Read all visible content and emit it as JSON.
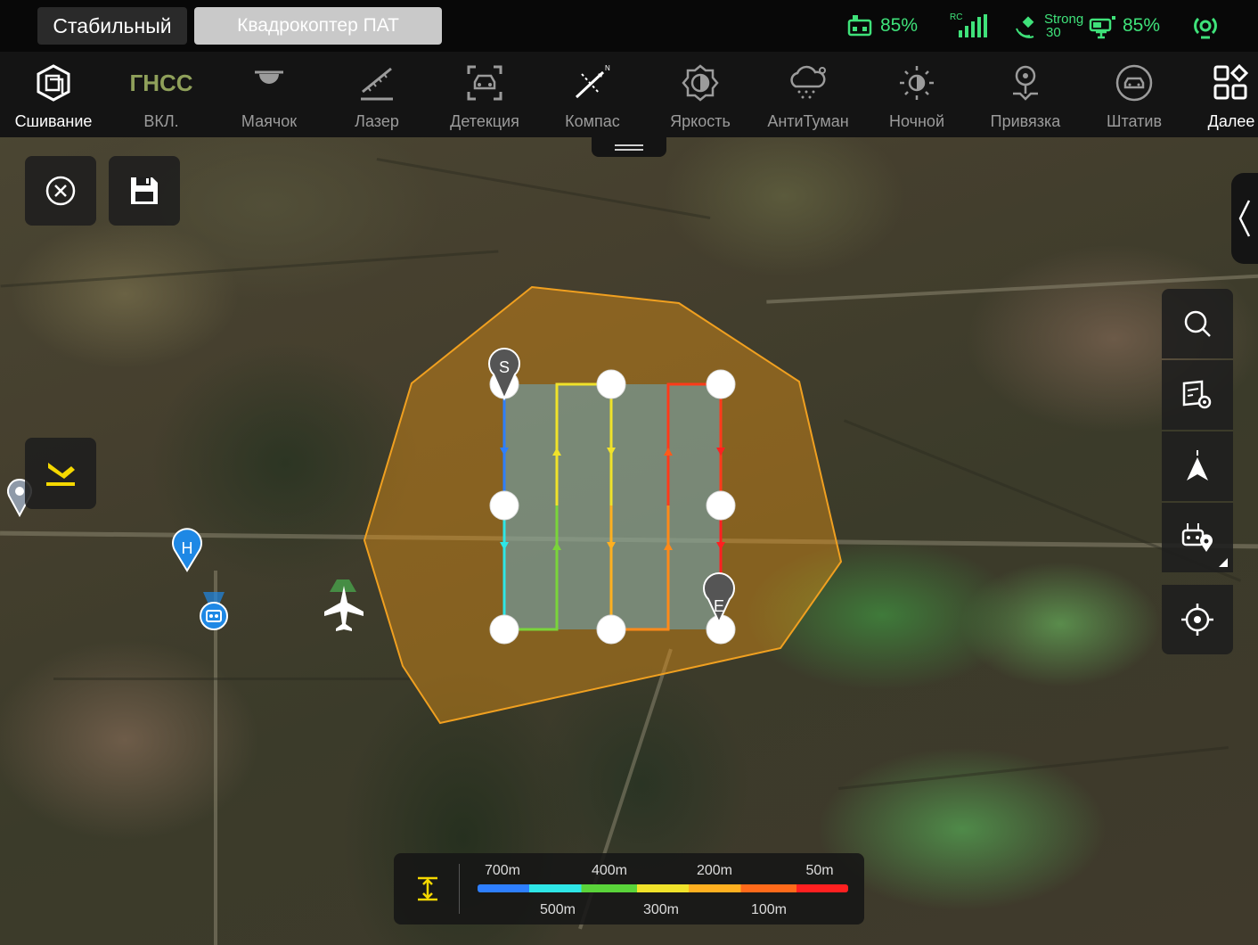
{
  "status_bar": {
    "mode": "Стабильный",
    "vehicle": "Квадрокоптер ПАТ",
    "rc_battery": "85%",
    "rc_label": "RC",
    "signal_text": "Strong",
    "signal_value": "30",
    "drone_battery": "85%"
  },
  "toolbar": {
    "items": [
      {
        "label": "Сшивание",
        "icon": "stitch-cube-icon",
        "active": true
      },
      {
        "label": "ВКЛ.",
        "icon_text": "ГНСС",
        "icon": "gnss-icon",
        "active": false
      },
      {
        "label": "Маячок",
        "icon": "beacon-icon",
        "active": false
      },
      {
        "label": "Лазер",
        "icon": "laser-ruler-icon",
        "active": false
      },
      {
        "label": "Детекция",
        "icon": "car-detection-icon",
        "active": false
      },
      {
        "label": "Компас",
        "icon": "compass-icon",
        "active": false
      },
      {
        "label": "Яркость",
        "icon": "brightness-icon",
        "active": false
      },
      {
        "label": "АнтиТуман",
        "icon": "defog-icon",
        "active": false
      },
      {
        "label": "Ночной",
        "icon": "night-mode-icon",
        "active": false
      },
      {
        "label": "Привязка",
        "icon": "pin-binding-icon",
        "active": false
      },
      {
        "label": "Штатив",
        "icon": "tripod-icon",
        "active": false
      },
      {
        "label": "Далее",
        "icon": "more-grid-icon",
        "active": true
      }
    ]
  },
  "map": {
    "start_marker": "S",
    "end_marker": "E",
    "home_marker": "H",
    "area_color": "#f0a020",
    "scan_color": "#6aa8b8"
  },
  "legend": {
    "top_labels": [
      "700m",
      "400m",
      "200m",
      "50m"
    ],
    "bottom_labels": [
      "500m",
      "300m",
      "100m"
    ]
  },
  "colors": {
    "status_green": "#3fe27a",
    "accent_yellow": "#f5d800",
    "poi_blue": "#1e88e5"
  }
}
